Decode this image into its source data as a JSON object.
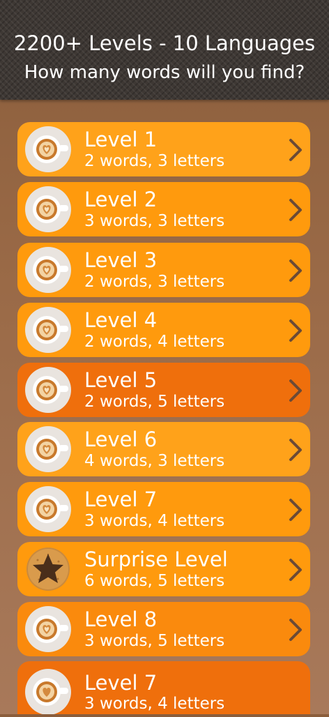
{
  "header": {
    "title": "2200+ Levels - 10 Languages",
    "subtitle": "How many words will you find?"
  },
  "colors": {
    "row_light": "#ffa21a",
    "row_mid": "#ff9a0d",
    "row_dark": "#ef6f0c",
    "chevron": "#6b4a36",
    "text": "#ffffff"
  },
  "levels": [
    {
      "label": "Level 1",
      "detail": "2 words, 3 letters",
      "icon": "latte-cup-icon"
    },
    {
      "label": "Level 2",
      "detail": "3 words, 3 letters",
      "icon": "latte-cup-icon"
    },
    {
      "label": "Level 3",
      "detail": "2 words, 3 letters",
      "icon": "latte-cup-icon"
    },
    {
      "label": "Level 4",
      "detail": "2 words, 4 letters",
      "icon": "latte-cup-icon"
    },
    {
      "label": "Level 5",
      "detail": "2 words, 5 letters",
      "icon": "latte-cup-icon"
    },
    {
      "label": "Level 6",
      "detail": "4 words, 3 letters",
      "icon": "latte-cup-icon"
    },
    {
      "label": "Level 7",
      "detail": "3 words, 4 letters",
      "icon": "latte-cup-icon"
    },
    {
      "label": "Surprise Level",
      "detail": "6 words, 5 letters",
      "icon": "star-cookie-icon"
    },
    {
      "label": "Level 8",
      "detail": "3 words, 5 letters",
      "icon": "latte-cup-icon"
    },
    {
      "label": "Level 7",
      "detail": "3 words, 4 letters",
      "icon": "latte-cup-icon"
    }
  ]
}
